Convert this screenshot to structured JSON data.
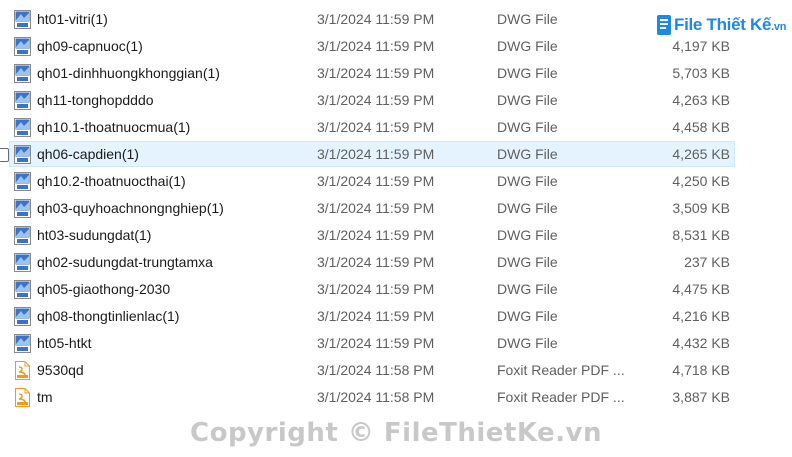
{
  "files": [
    {
      "name": "ht01-vitri(1)",
      "date": "3/1/2024 11:59 PM",
      "type": "DWG File",
      "size": "",
      "icon": "dwg-file-icon"
    },
    {
      "name": "qh09-capnuoc(1)",
      "date": "3/1/2024 11:59 PM",
      "type": "DWG File",
      "size": "4,197 KB",
      "icon": "dwg-file-icon"
    },
    {
      "name": "qh01-dinhhuongkhonggian(1)",
      "date": "3/1/2024 11:59 PM",
      "type": "DWG File",
      "size": "5,703 KB",
      "icon": "dwg-file-icon"
    },
    {
      "name": "qh11-tonghopdddo",
      "date": "3/1/2024 11:59 PM",
      "type": "DWG File",
      "size": "4,263 KB",
      "icon": "dwg-file-icon"
    },
    {
      "name": "qh10.1-thoatnuocmua(1)",
      "date": "3/1/2024 11:59 PM",
      "type": "DWG File",
      "size": "4,458 KB",
      "icon": "dwg-file-icon"
    },
    {
      "name": "qh06-capdien(1)",
      "date": "3/1/2024 11:59 PM",
      "type": "DWG File",
      "size": "4,265 KB",
      "icon": "dwg-file-icon",
      "selected": true
    },
    {
      "name": "qh10.2-thoatnuocthai(1)",
      "date": "3/1/2024 11:59 PM",
      "type": "DWG File",
      "size": "4,250 KB",
      "icon": "dwg-file-icon"
    },
    {
      "name": "qh03-quyhoachnongnghiep(1)",
      "date": "3/1/2024 11:59 PM",
      "type": "DWG File",
      "size": "3,509 KB",
      "icon": "dwg-file-icon"
    },
    {
      "name": "ht03-sudungdat(1)",
      "date": "3/1/2024 11:59 PM",
      "type": "DWG File",
      "size": "8,531 KB",
      "icon": "dwg-file-icon"
    },
    {
      "name": "qh02-sudungdat-trungtamxa",
      "date": "3/1/2024 11:59 PM",
      "type": "DWG File",
      "size": "237 KB",
      "icon": "dwg-file-icon"
    },
    {
      "name": "qh05-giaothong-2030",
      "date": "3/1/2024 11:59 PM",
      "type": "DWG File",
      "size": "4,475 KB",
      "icon": "dwg-file-icon"
    },
    {
      "name": "qh08-thongtinlienlac(1)",
      "date": "3/1/2024 11:59 PM",
      "type": "DWG File",
      "size": "4,216 KB",
      "icon": "dwg-file-icon"
    },
    {
      "name": "ht05-htkt",
      "date": "3/1/2024 11:59 PM",
      "type": "DWG File",
      "size": "4,432 KB",
      "icon": "dwg-file-icon"
    },
    {
      "name": "9530qd",
      "date": "3/1/2024 11:58 PM",
      "type": "Foxit Reader PDF ...",
      "size": "4,718 KB",
      "icon": "pdf-file-icon"
    },
    {
      "name": "tm",
      "date": "3/1/2024 11:58 PM",
      "type": "Foxit Reader PDF ...",
      "size": "3,887 KB",
      "icon": "pdf-file-icon"
    }
  ],
  "logo": {
    "main": "File Thiết Kế",
    "suffix": ".vn"
  },
  "watermark": "Copyright © FileThietKe.vn",
  "colors": {
    "selection": "#e5f3ff",
    "dwg_icon": "#3a73c8",
    "pdf_icon": "#f29a1f",
    "logo": "#1e88e5"
  }
}
